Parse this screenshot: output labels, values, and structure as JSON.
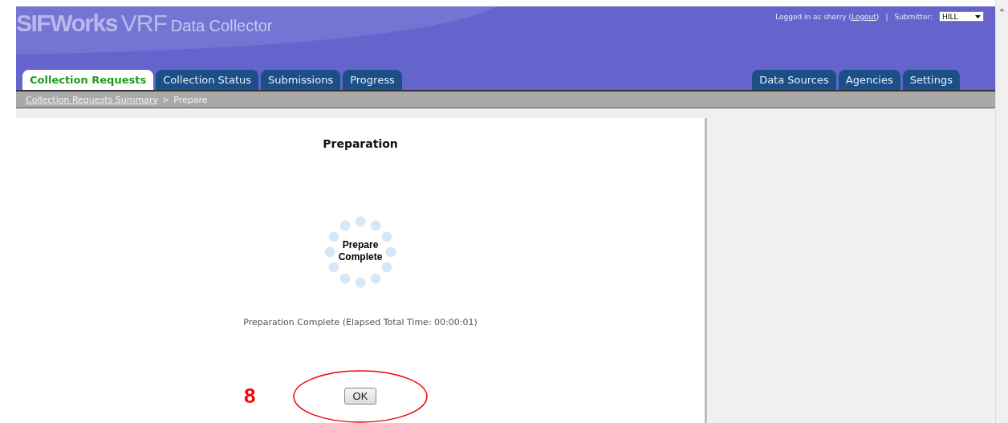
{
  "logo": {
    "brand": "SIFWorks",
    "product": "VRF",
    "subtitle": "Data Collector"
  },
  "user_bar": {
    "prefix": "Logged in as sherry (",
    "logout": "Logout",
    "suffix": ")",
    "separator": "|",
    "submitter_label": "Submitter:",
    "submitter_value": "HILL"
  },
  "tabs_left": [
    {
      "label": "Collection Requests",
      "selected": true
    },
    {
      "label": "Collection Status",
      "selected": false
    },
    {
      "label": "Submissions",
      "selected": false
    },
    {
      "label": "Progress",
      "selected": false
    }
  ],
  "tabs_right": [
    {
      "label": "Data Sources",
      "selected": false
    },
    {
      "label": "Agencies",
      "selected": false
    },
    {
      "label": "Settings",
      "selected": false
    }
  ],
  "breadcrumb": {
    "link": "Collection Requests Summary",
    "separator": ">",
    "current": "Prepare"
  },
  "panel": {
    "title": "Preparation",
    "spinner_lines": [
      "Prepare",
      "Complete"
    ],
    "status": "Preparation Complete (Elapsed Total Time: 00:00:01)",
    "button": "OK"
  },
  "annotation": {
    "number": "8"
  }
}
